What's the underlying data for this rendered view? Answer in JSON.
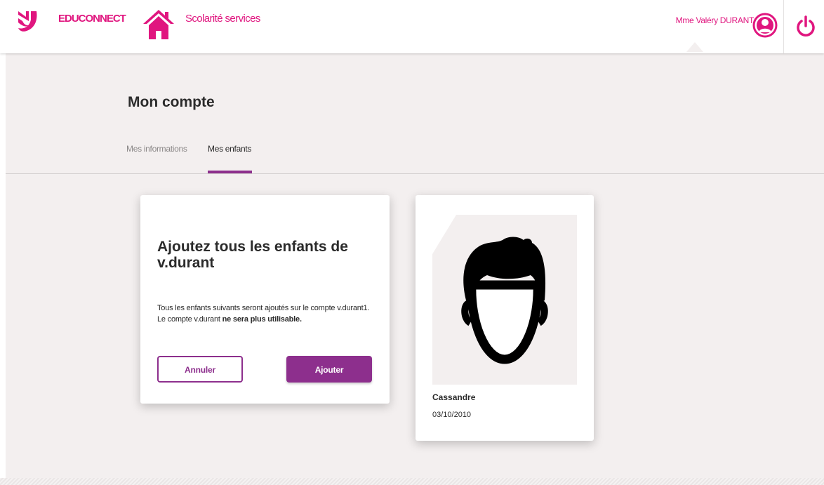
{
  "header": {
    "brand": "EDUCONNECT",
    "service": "Scolarité services",
    "user_name": "Mme Valéry DURANT",
    "icons": [
      "educonnect-logo-icon",
      "home-icon",
      "user-avatar-icon",
      "power-icon"
    ]
  },
  "page": {
    "title": "Mon compte",
    "tabs": [
      {
        "label": "Mes informations",
        "active": false
      },
      {
        "label": "Mes enfants",
        "active": true
      }
    ]
  },
  "add_card": {
    "title": "Ajoutez tous les enfants de v.durant",
    "text_line1": "Tous les enfants suivants seront ajoutés sur le compte v.durant1.",
    "text_line2_prefix": "Le compte v.durant ",
    "text_line2_bold": "ne sera plus utilisable.",
    "cancel_label": "Annuler",
    "add_label": "Ajouter"
  },
  "child_card": {
    "name": "Cassandre",
    "birth_date": "03/10/2010"
  },
  "colors": {
    "brand_pink": "#e0167f",
    "accent_purple": "#8d2f8d",
    "background": "#f3efef"
  }
}
